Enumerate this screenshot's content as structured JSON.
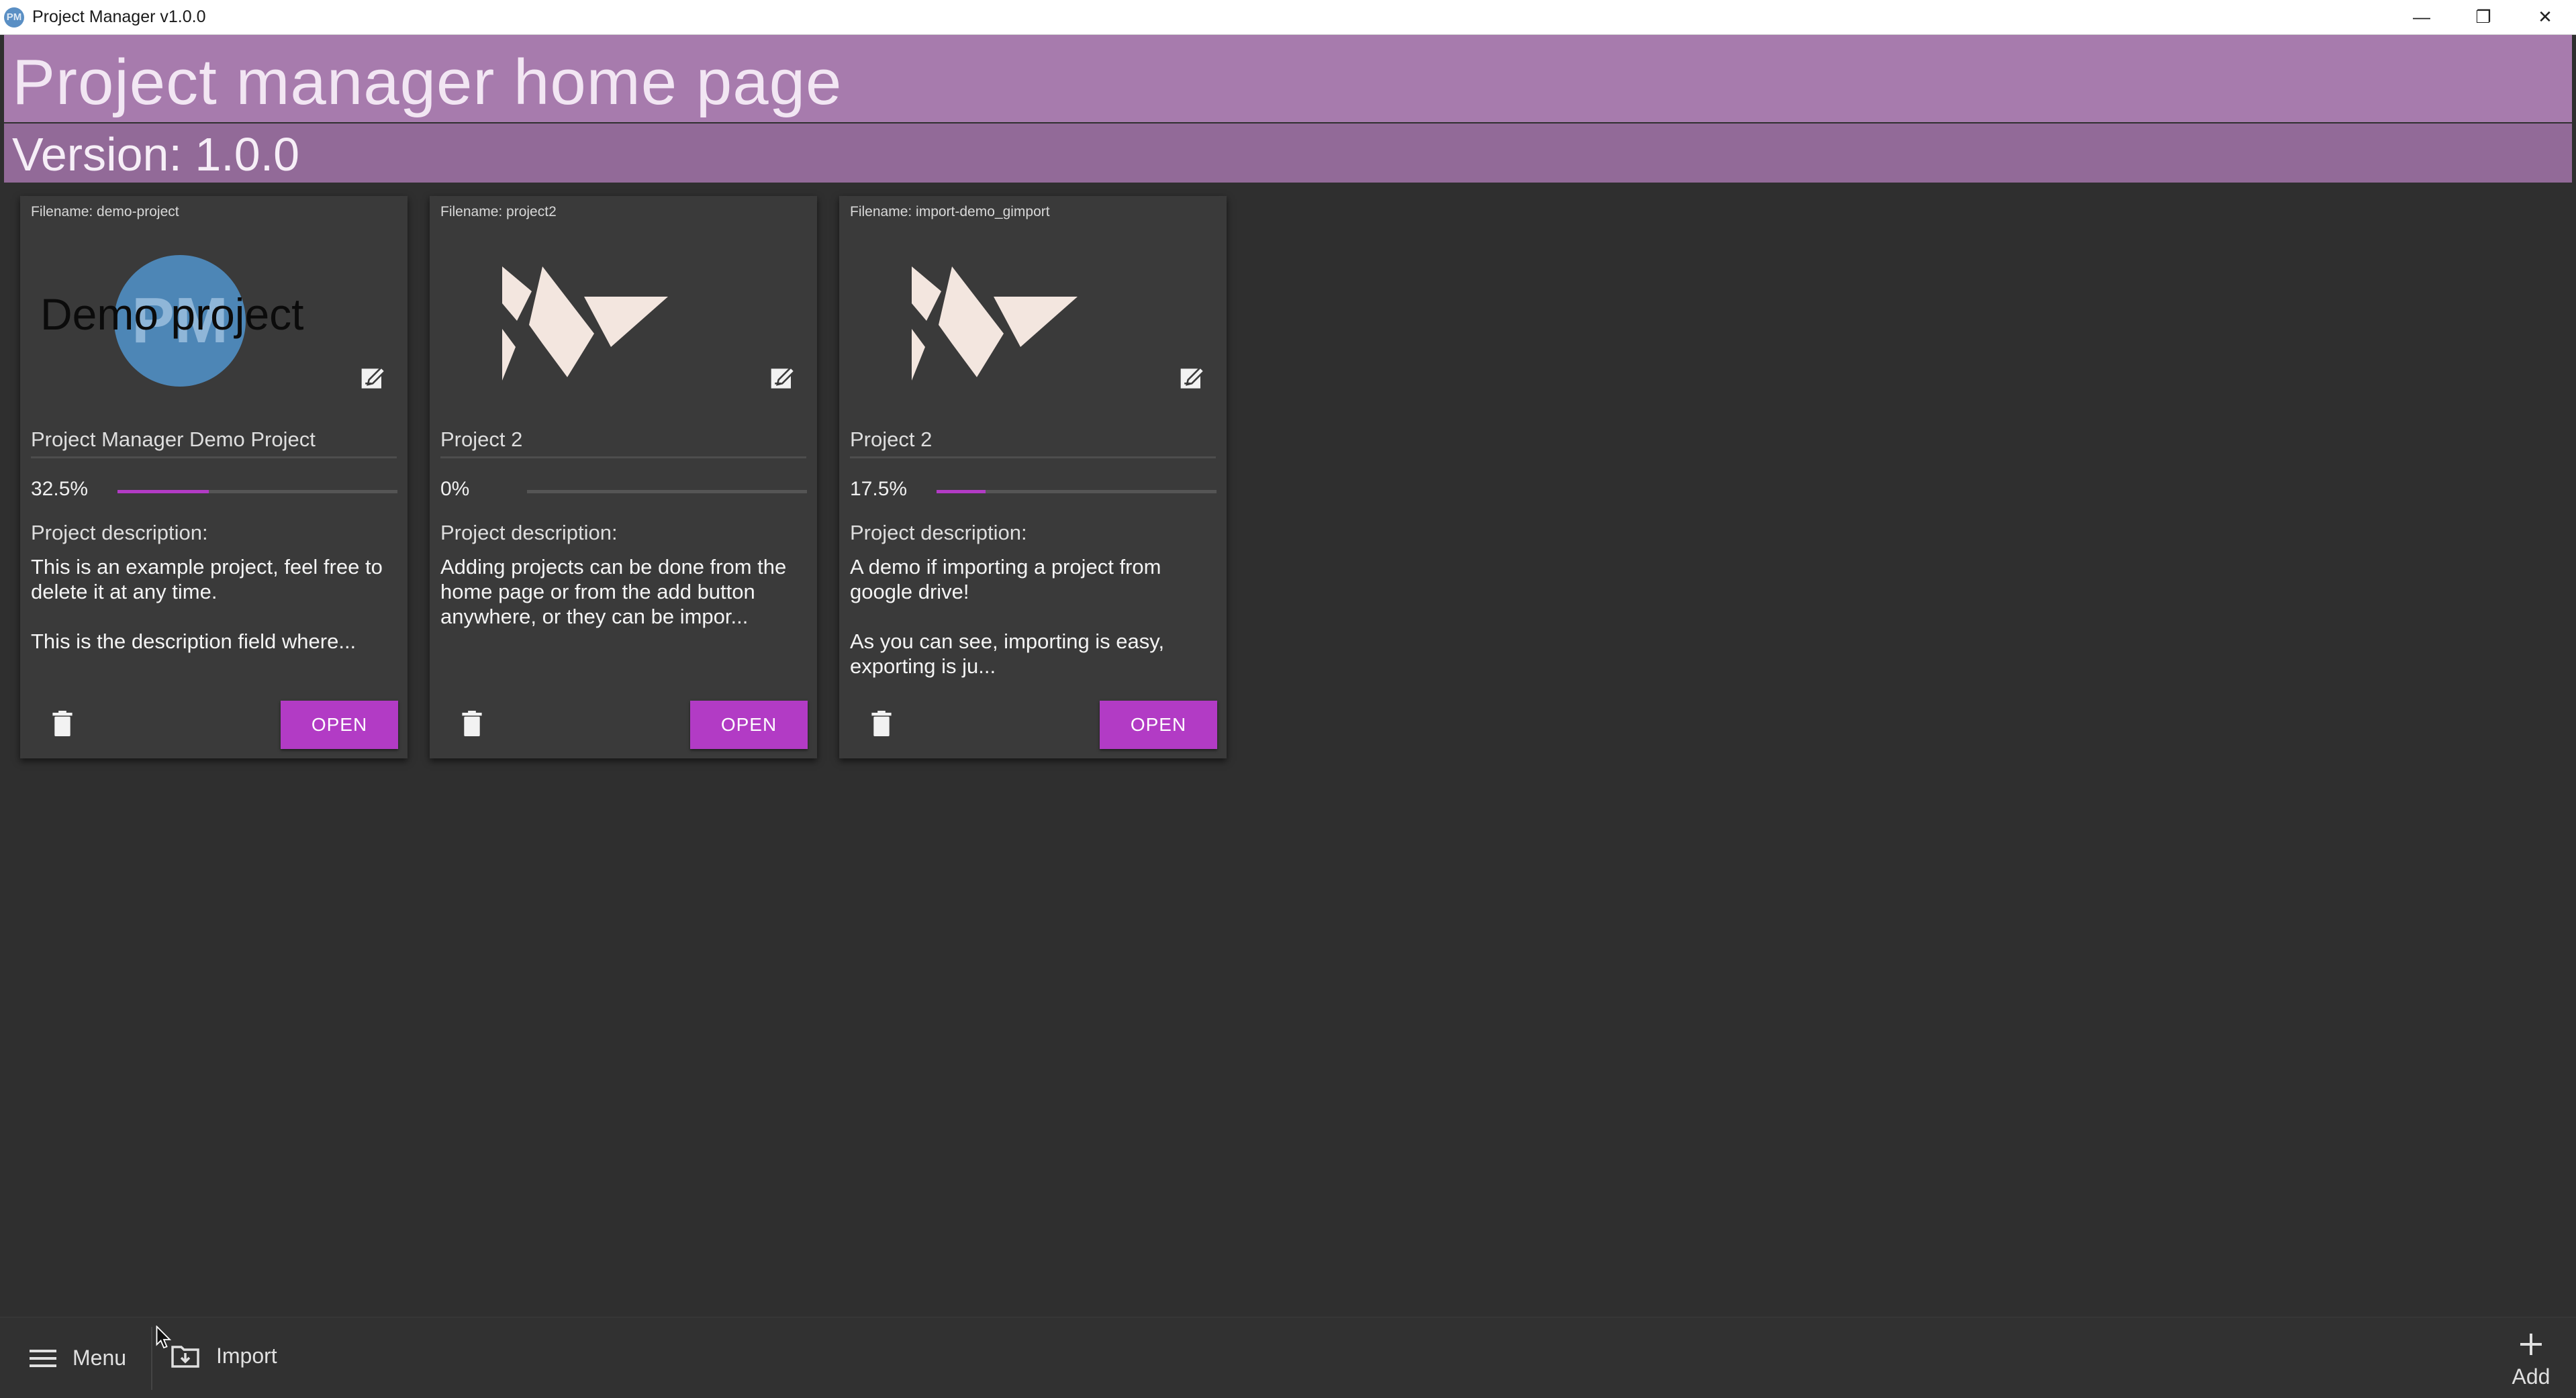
{
  "window": {
    "title": "Project Manager v1.0.0",
    "app_icon_text": "PM",
    "minimize": "—",
    "restore": "❐",
    "close": "✕"
  },
  "header": {
    "title": "Project manager home page",
    "version": "Version: 1.0.0"
  },
  "colors": {
    "header_top": "#a77bad",
    "header_bottom": "#926a98",
    "accent": "#b23bc5",
    "background": "#2f2f2f",
    "card": "#3a3a3a"
  },
  "cards": [
    {
      "filename": "Filename: demo-project",
      "logo_type": "pm-logo",
      "logo_letters": "PM",
      "logo_text": "Demo project",
      "title": "Project Manager Demo Project",
      "progress_text": "32.5%",
      "progress": 32.5,
      "description_label": "Project description:",
      "description": "This is an example project, feel free to\ndelete it at any time.\n\nThis is the description field where...",
      "open_label": "OPEN",
      "edit_icon": "edit-icon",
      "delete_icon": "trash-icon"
    },
    {
      "filename": "Filename: project2",
      "logo_type": "kivy-logo",
      "title": "Project 2",
      "progress_text": "0%",
      "progress": 0,
      "description_label": "Project description:",
      "description": "Adding projects can be done from the\nhome page or from the add button\nanywhere, or they can be impor...",
      "open_label": "OPEN",
      "edit_icon": "edit-icon",
      "delete_icon": "trash-icon"
    },
    {
      "filename": "Filename: import-demo_gimport",
      "logo_type": "kivy-logo",
      "title": "Project 2",
      "progress_text": "17.5%",
      "progress": 17.5,
      "description_label": "Project description:",
      "description": "A demo if importing a project from\ngoogle drive!\n\nAs you can see, importing is easy,\nexporting is ju...",
      "open_label": "OPEN",
      "edit_icon": "edit-icon",
      "delete_icon": "trash-icon"
    }
  ],
  "bottom_bar": {
    "menu_label": "Menu",
    "menu_icon": "hamburger-icon",
    "import_label": "Import",
    "import_icon": "folder-import-icon",
    "add_label": "Add",
    "add_icon": "plus-icon"
  }
}
